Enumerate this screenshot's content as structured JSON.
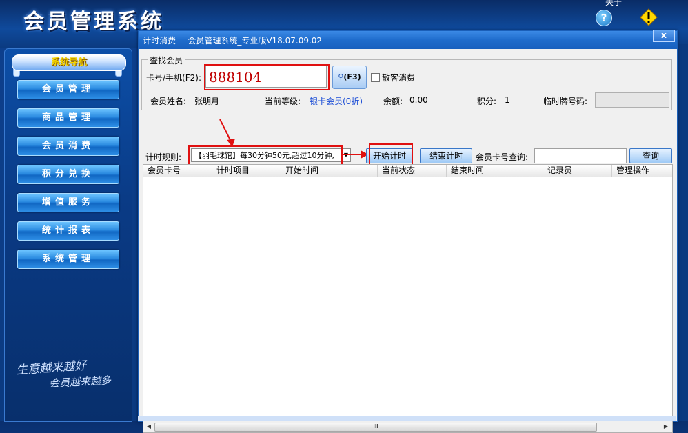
{
  "app": {
    "title": "会员管理系统",
    "top_text": "关于",
    "help_icon_glyph": "?",
    "warn_icon_glyph": "!"
  },
  "sidebar": {
    "header": "系统导航",
    "items": [
      {
        "label": "会员管理"
      },
      {
        "label": "商品管理"
      },
      {
        "label": "会员消费"
      },
      {
        "label": "积分兑换"
      },
      {
        "label": "增值服务"
      },
      {
        "label": "统计报表"
      },
      {
        "label": "系统管理"
      }
    ],
    "slogan_line1": "生意越来越好",
    "slogan_line2": "会员越来越多"
  },
  "dialog": {
    "title": "计时消费----会员管理系统_专业版V18.07.09.02",
    "close_glyph": "x",
    "group_legend": "查找会员",
    "card_label": "卡号/手机(F2):",
    "card_value": "888104",
    "search_button": "(F3)",
    "walkin_label": "散客消费",
    "member_name_label": "会员姓名:",
    "member_name_value": "张明月",
    "level_label": "当前等级:",
    "level_value": "银卡会员(0折)",
    "balance_label": "余额:",
    "balance_value": "0.00",
    "points_label": "积分:",
    "points_value": "1",
    "temp_card_label": "临时牌号码:",
    "rule_label": "计时规则:",
    "rule_value": "【羽毛球馆】每30分钟50元,超过10分钟,",
    "start_button": "开始计时",
    "end_button": "结束计时",
    "card_query_label": "会员卡号查询:",
    "query_button": "查询",
    "table": {
      "columns": [
        "会员卡号",
        "计时项目",
        "开始时间",
        "当前状态",
        "结束时间",
        "记录员",
        "管理操作"
      ],
      "rows": []
    },
    "scroll_grip": "III"
  },
  "colors": {
    "accent": "#1f6ccc",
    "highlight": "#e01010",
    "card_value": "#c00000",
    "link": "#1e4fd6"
  }
}
